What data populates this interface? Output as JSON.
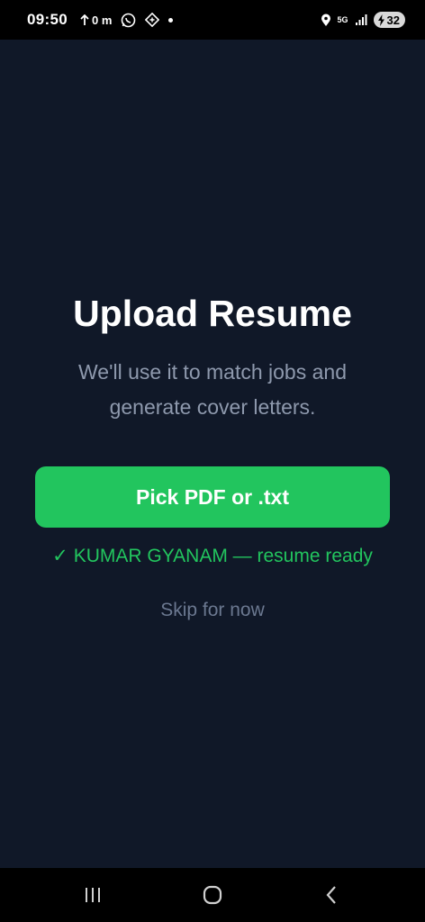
{
  "status_bar": {
    "time": "09:50",
    "network_speed": "0 m",
    "battery_level": "32",
    "network_type": "5G",
    "icons": [
      "upload-arrow-icon",
      "whatsapp-icon",
      "app-icon",
      "notification-dot-icon",
      "location-icon",
      "5g-icon",
      "signal-icon",
      "battery-charging-icon"
    ]
  },
  "main": {
    "title": "Upload Resume",
    "subtitle": "We'll use it to match jobs and generate cover letters.",
    "pick_button_label": "Pick PDF or .txt",
    "status_check": "✓",
    "status_text": "KUMAR GYANAM — resume ready",
    "skip_label": "Skip for now"
  },
  "nav_bar": {
    "icons": [
      "recent-apps-icon",
      "home-icon",
      "back-icon"
    ]
  },
  "colors": {
    "background": "#101828",
    "accent_green": "#22c55e",
    "subtitle_gray": "#8e99ad",
    "skip_gray": "#6b7890"
  }
}
